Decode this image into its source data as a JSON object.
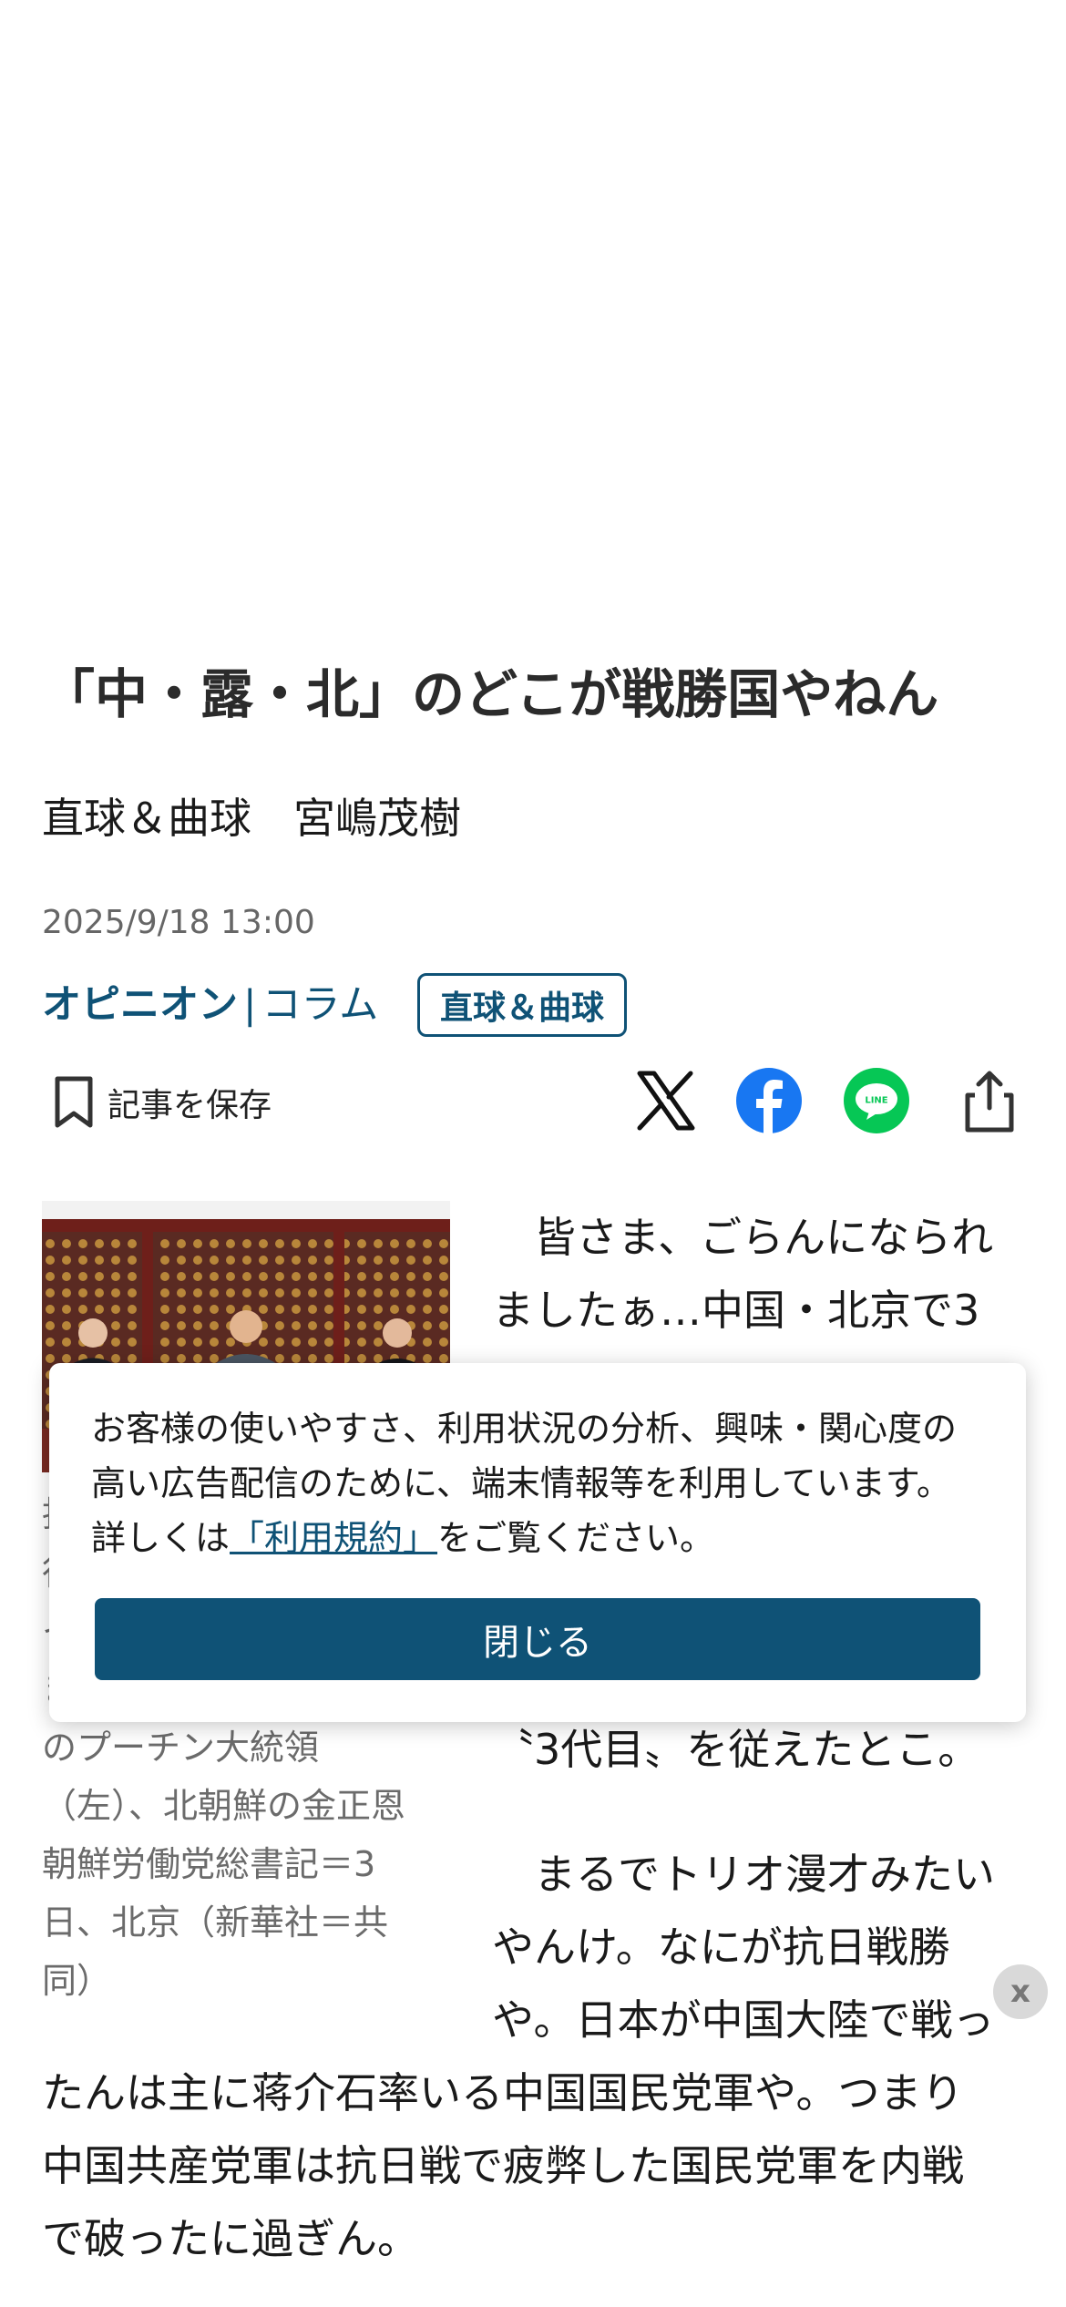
{
  "article": {
    "title": "「中・露・北」のどこが戦勝国やねん",
    "byline": "直球＆曲球　宮嶋茂樹",
    "date": "2025/9/18 13:00",
    "category_main": "オピニオン",
    "category_sep": "|",
    "category_sub": "コラム",
    "tag": "直球＆曲球",
    "save_label": "記事を保存",
    "caption_lines": [
      "抗",
      "行",
      "イ",
      "ま",
      "のプーチン大統領",
      "（左）、北朝鮮の金正恩",
      "朝鮮労働党総書記＝3",
      "日、北京（新華社＝共",
      "同）"
    ],
    "para1_lines": [
      "　皆さま、ごらんになられ",
      "ましたぁ…中国・北京で3"
    ],
    "para1_end": "〝3代目〟を従えたとこ。",
    "para2_lines": [
      "　まるでトリオ漫才みたい",
      "やんけ。なにが抗日戦勝",
      "や。日本が中国大陸で戦っ"
    ],
    "para3_lines": [
      "たんは主に蒋介石率いる中国国民党軍や。つまり",
      "中国共産党軍は抗日戦で疲弊した国民党軍を内戦",
      "で破ったに過ぎん。"
    ]
  },
  "share": {
    "icons": [
      "x-icon",
      "facebook-icon",
      "line-icon",
      "share-icon"
    ],
    "line_label": "LINE"
  },
  "cookie": {
    "text_line1": "お客様の使いやすさ、利用状況の分析、興味・関心度の",
    "text_line2": "高い広告配信のために、端末情報等を利用しています。",
    "text_pre": "詳しくは",
    "link": "「利用規約」",
    "text_post": "をご覧ください。",
    "close_label": "閉じる"
  },
  "overlay": {
    "dismiss_label": "x"
  },
  "colors": {
    "accent": "#0f5276",
    "facebook": "#1877f2",
    "line": "#06c755"
  }
}
